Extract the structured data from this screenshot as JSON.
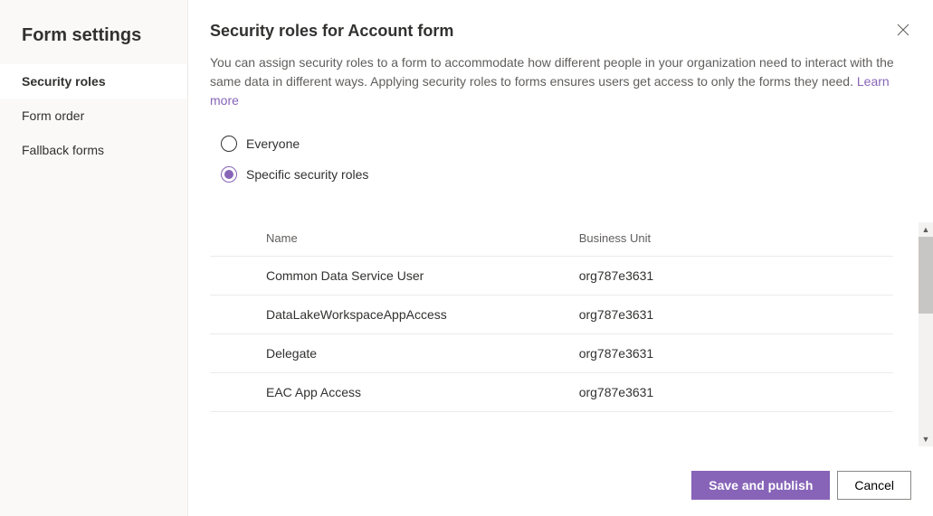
{
  "sidebar": {
    "title": "Form settings",
    "items": [
      {
        "label": "Security roles",
        "active": true
      },
      {
        "label": "Form order",
        "active": false
      },
      {
        "label": "Fallback forms",
        "active": false
      }
    ]
  },
  "main": {
    "title": "Security roles for Account form",
    "description": "You can assign security roles to a form to accommodate how different people in your organization need to interact with the same data in different ways. Applying security roles to forms ensures users get access to only the forms they need. ",
    "learn_more": "Learn more"
  },
  "radio": {
    "everyone": "Everyone",
    "specific": "Specific security roles",
    "selected": "specific"
  },
  "table": {
    "headers": {
      "name": "Name",
      "business_unit": "Business Unit"
    },
    "rows": [
      {
        "name": "Common Data Service User",
        "business_unit": "org787e3631"
      },
      {
        "name": "DataLakeWorkspaceAppAccess",
        "business_unit": "org787e3631"
      },
      {
        "name": "Delegate",
        "business_unit": "org787e3631"
      },
      {
        "name": "EAC App Access",
        "business_unit": "org787e3631"
      }
    ]
  },
  "footer": {
    "save_publish": "Save and publish",
    "cancel": "Cancel"
  }
}
